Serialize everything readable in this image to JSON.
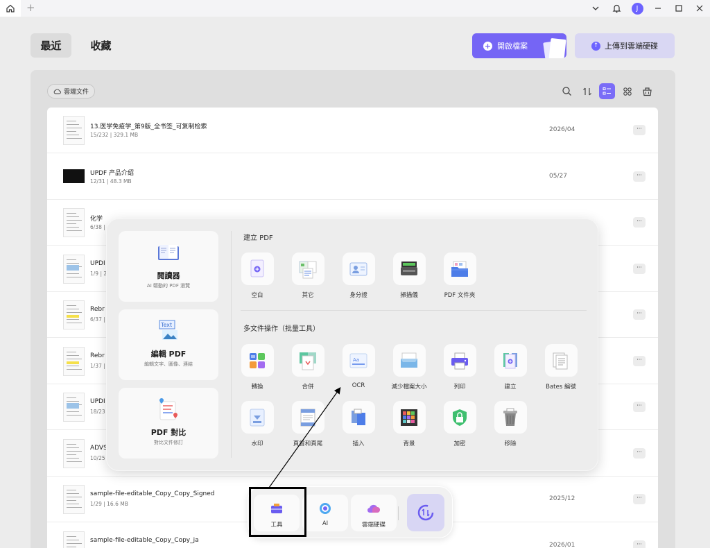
{
  "titlebar": {
    "avatar_letter": "J"
  },
  "header": {
    "tab_recent": "最近",
    "tab_favorites": "收藏",
    "open_file": "開啟檔案",
    "upload_cloud": "上傳到雲端硬碟"
  },
  "panel": {
    "cloud_docs": "雲端文件"
  },
  "files": [
    {
      "name": "13.医学免疫学_第9版_全书签_可复制检索",
      "meta": "15/232 | 329.1 MB",
      "date": "2026/04"
    },
    {
      "name": "UPDF 产品介绍",
      "meta": "12/31 | 48.3 MB",
      "date": "05/27"
    },
    {
      "name": "化学",
      "meta": "6/38 |",
      "date": ""
    },
    {
      "name": "UPDI",
      "meta": "1/9 | 2",
      "date": ""
    },
    {
      "name": "Rebr",
      "meta": "6/37 |",
      "date": ""
    },
    {
      "name": "Rebr",
      "meta": "1/37 |",
      "date": ""
    },
    {
      "name": "UPDI",
      "meta": "18/23",
      "date": ""
    },
    {
      "name": "ADVS",
      "meta": "10/25",
      "date": ""
    },
    {
      "name": "sample-file-editable_Copy_Copy_Signed",
      "meta": "1/29 | 16.6 MB",
      "date": "2025/12"
    },
    {
      "name": "sample-file-editable_Copy_Copy_ja",
      "meta": "",
      "date": "2026/01"
    }
  ],
  "popup": {
    "reader": {
      "title": "閱讀器",
      "sub": "AI 驅動的 PDF 瀏覽"
    },
    "edit": {
      "title": "編輯 PDF",
      "sub": "編輯文字、圖像、連結"
    },
    "compare": {
      "title": "PDF 對比",
      "sub": "對比文件修訂"
    },
    "create_title": "建立 PDF",
    "create_items": [
      "空白",
      "其它",
      "身分證",
      "掃描儀",
      "PDF 文件夾"
    ],
    "batch_title": "多文件操作（批量工具）",
    "batch_row1": [
      "轉換",
      "合併",
      "OCR",
      "減少檔案大小",
      "列印",
      "建立",
      "Bates 編號"
    ],
    "batch_row2": [
      "水印",
      "頁首和頁尾",
      "插入",
      "背景",
      "加密",
      "移除"
    ]
  },
  "dock": {
    "tools": "工具",
    "ai": "AI",
    "cloud": "雲端硬碟"
  },
  "colors": {
    "accent": "#7565f5",
    "accent_light": "#d9d7f3"
  }
}
